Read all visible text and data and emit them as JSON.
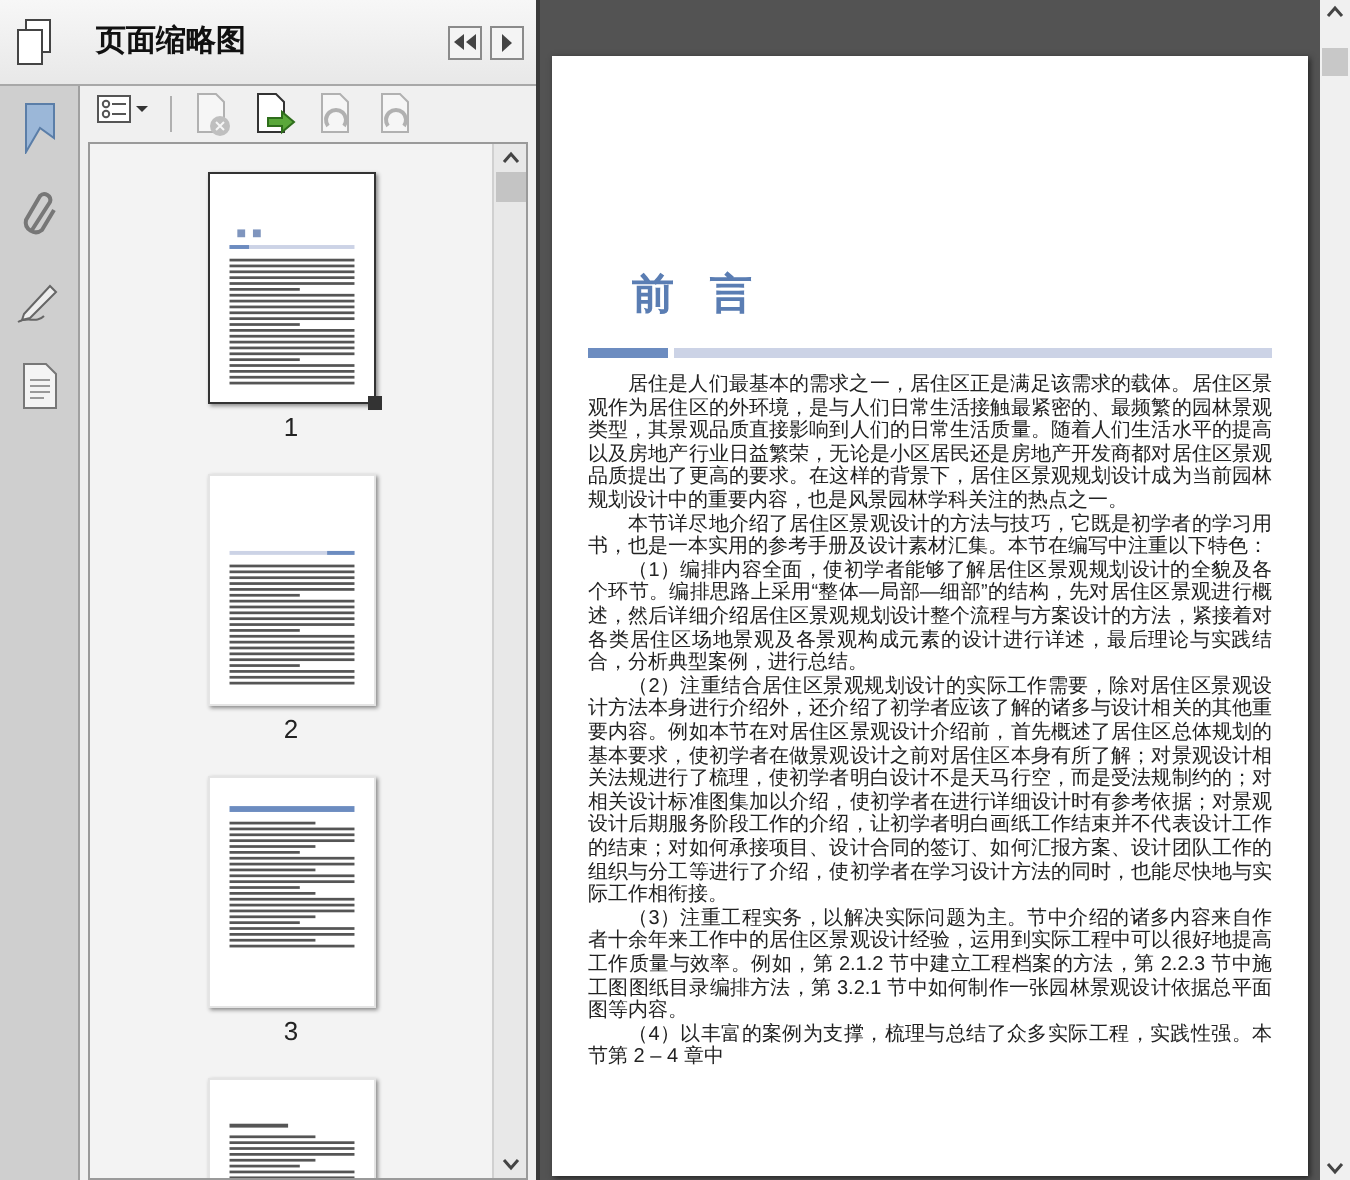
{
  "panel": {
    "title": "页面缩略图"
  },
  "toolbar": [
    {
      "kind": "options",
      "disabled": false
    },
    {
      "kind": "delete",
      "disabled": true
    },
    {
      "kind": "insert",
      "disabled": false
    },
    {
      "kind": "rotate-left",
      "disabled": true
    },
    {
      "kind": "rotate-right",
      "disabled": true
    }
  ],
  "thumbnails": [
    {
      "label": "1",
      "selected": true
    },
    {
      "label": "2",
      "selected": false
    },
    {
      "label": "3",
      "selected": false
    },
    {
      "selected": false
    }
  ],
  "document": {
    "heading": "前 言",
    "paragraphs": [
      "居住是人们最基本的需求之一，居住区正是满足该需求的载体。居住区景观作为居住区的外环境，是与人们日常生活接触最紧密的、最频繁的园林景观类型，其景观品质直接影响到人们的日常生活质量。随着人们生活水平的提高以及房地产行业日益繁荣，无论是小区居民还是房地产开发商都对居住区景观品质提出了更高的要求。在这样的背景下，居住区景观规划设计成为当前园林规划设计中的重要内容，也是风景园林学科关注的热点之一。",
      "本节详尽地介绍了居住区景观设计的方法与技巧，它既是初学者的学习用书，也是一本实用的参考手册及设计素材汇集。本节在编写中注重以下特色：",
      "（1）编排内容全面，使初学者能够了解居住区景观规划设计的全貌及各个环节。编排思路上采用“整体—局部—细部”的结构，先对居住区景观进行概述，然后详细介绍居住区景观规划设计整个流程与方案设计的方法，紧接着对各类居住区场地景观及各景观构成元素的设计进行详述，最后理论与实践结合，分析典型案例，进行总结。",
      "（2）注重结合居住区景观规划设计的实际工作需要，除对居住区景观设计方法本身进行介绍外，还介绍了初学者应该了解的诸多与设计相关的其他重要内容。例如本节在对居住区景观设计介绍前，首先概述了居住区总体规划的基本要求，使初学者在做景观设计之前对居住区本身有所了解；对景观设计相关法规进行了梳理，使初学者明白设计不是天马行空，而是受法规制约的；对相关设计标准图集加以介绍，使初学者在进行详细设计时有参考依据；对景观设计后期服务阶段工作的介绍，让初学者明白画纸工作结束并不代表设计工作的结束；对如何承接项目、设计合同的签订、如何汇报方案、设计团队工作的组织与分工等进行了介绍，使初学者在学习设计方法的同时，也能尽快地与实际工作相衔接。",
      "（3）注重工程实务，以解决实际问题为主。节中介绍的诸多内容来自作者十余年来工作中的居住区景观设计经验，运用到实际工程中可以很好地提高工作质量与效率。例如，第 2.1.2 节中建立工程档案的方法，第 2.2.3 节中施工图图纸目录编排方法，第 3.2.1 节中如何制作一张园林景观设计依据总平面图等内容。",
      "（4）以丰富的案例为支撑，梳理与总结了众多实际工程，实践性强。本节第 2 – 4 章中"
    ]
  }
}
